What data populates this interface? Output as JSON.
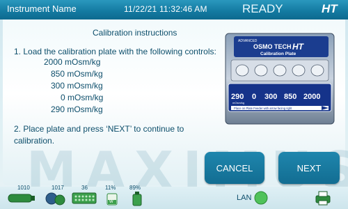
{
  "header": {
    "instrument_name": "Instrument Name",
    "datetime": "11/22/21 11:32:46 AM",
    "status": "READY",
    "logo": "HT"
  },
  "main": {
    "title": "Calibration instructions",
    "step1": "1. Load the calibration plate with the following controls:",
    "controls": [
      "2000 mOsm/kg",
      "850 mOsm/kg",
      "300 mOsm/kg",
      "0 mOsm/kg",
      "290 mOsm/kg"
    ],
    "step2": "2. Place plate and press ‘NEXT’ to continue to calibration.",
    "watermark": "MAXIMUS"
  },
  "plate": {
    "brand_small": "ADVANCED",
    "brand": "OSMO TECH",
    "model": "HT",
    "caption": "Calibration Plate",
    "wells": [
      "290",
      "0",
      "300",
      "850",
      "2000"
    ],
    "well_unit": "mOsm/kg",
    "instruction": "Place on Plate Feeder with arrow facing right"
  },
  "buttons": {
    "cancel": "CANCEL",
    "next": "NEXT"
  },
  "footer": {
    "counts": [
      "1010",
      "1017",
      "36",
      "11%",
      "89%"
    ],
    "lan_label": "LAN"
  },
  "colors": {
    "header": "#1a85ad",
    "button": "#1a7ca2",
    "text": "#0d4e6b",
    "lan_status": "#4fc25a"
  }
}
